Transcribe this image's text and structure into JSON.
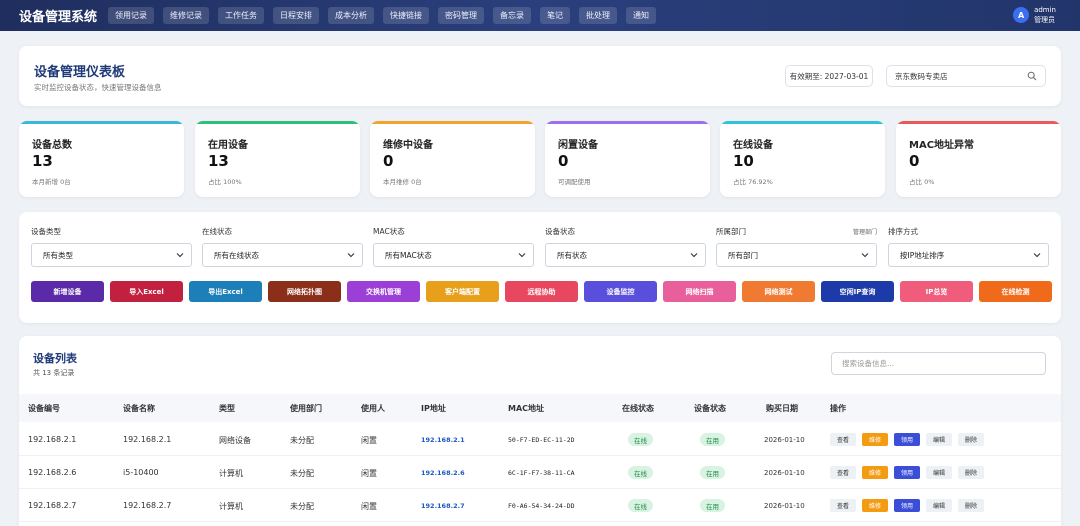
{
  "app": {
    "title": "设备管理系统",
    "nav": [
      "领用记录",
      "维修记录",
      "工作任务",
      "日程安排",
      "成本分析",
      "快捷链接",
      "密码管理",
      "备忘录",
      "笔记",
      "批处理",
      "通知"
    ],
    "user": {
      "avatar": "A",
      "name": "admin",
      "role": "管理员"
    }
  },
  "header": {
    "title": "设备管理仪表板",
    "subtitle": "实时监控设备状态，快速管理设备信息",
    "validity": "有效期至: 2027-03-01",
    "shop": "京东数码专卖店"
  },
  "stats": [
    {
      "label": "设备总数",
      "value": "13",
      "sub": "本月新增 0台",
      "color": "#3bb8d8"
    },
    {
      "label": "在用设备",
      "value": "13",
      "sub": "占比 100%",
      "color": "#2fbf7a"
    },
    {
      "label": "维修中设备",
      "value": "0",
      "sub": "本月维修 0台",
      "color": "#f0a531"
    },
    {
      "label": "闲置设备",
      "value": "0",
      "sub": "可调配使用",
      "color": "#9b6ff0"
    },
    {
      "label": "在线设备",
      "value": "10",
      "sub": "占比 76.92%",
      "color": "#2fc4d8"
    },
    {
      "label": "MAC地址异常",
      "value": "0",
      "sub": "占比 0%",
      "color": "#e85b5b"
    }
  ],
  "filters": {
    "groups": [
      {
        "label": "设备类型",
        "value": "所有类型"
      },
      {
        "label": "在线状态",
        "value": "所有在线状态"
      },
      {
        "label": "MAC状态",
        "value": "所有MAC状态"
      },
      {
        "label": "设备状态",
        "value": "所有状态"
      },
      {
        "label": "所属部门",
        "value": "所有部门",
        "extra": "管理部门"
      },
      {
        "label": "排序方式",
        "value": "按IP地址排序"
      }
    ],
    "buttons": [
      {
        "label": "新增设备",
        "color": "#5b2aa8"
      },
      {
        "label": "导入Excel",
        "color": "#c2203f"
      },
      {
        "label": "导出Excel",
        "color": "#1c7fb8"
      },
      {
        "label": "网络拓扑图",
        "color": "#8c2f1a"
      },
      {
        "label": "交换机管理",
        "color": "#9b3fd6"
      },
      {
        "label": "客户端配置",
        "color": "#e8a01c"
      },
      {
        "label": "远程协助",
        "color": "#e8485f"
      },
      {
        "label": "设备监控",
        "color": "#5a4fdc"
      },
      {
        "label": "网络扫描",
        "color": "#e85f9c"
      },
      {
        "label": "网络测试",
        "color": "#f07a32"
      },
      {
        "label": "空闲IP查询",
        "color": "#1c3aa8"
      },
      {
        "label": "IP总览",
        "color": "#ef5c7c"
      },
      {
        "label": "在线检测",
        "color": "#f06a1c"
      }
    ]
  },
  "table": {
    "title": "设备列表",
    "count": "共 13 条记录",
    "search_placeholder": "搜索设备信息...",
    "columns": [
      "设备编号",
      "设备名称",
      "类型",
      "使用部门",
      "使用人",
      "IP地址",
      "MAC地址",
      "在线状态",
      "设备状态",
      "购买日期",
      "操作"
    ],
    "actions": [
      "查看",
      "维修",
      "领用",
      "编辑",
      "删除"
    ],
    "rows": [
      {
        "id": "192.168.2.1",
        "name": "192.168.2.1",
        "type": "网络设备",
        "dept": "未分配",
        "user": "闲置",
        "ip": "192.168.2.1",
        "mac": "50-F7-ED-EC-11-2D",
        "online": "在线",
        "status": "在用",
        "date": "2026-01-10"
      },
      {
        "id": "192.168.2.6",
        "name": "i5-10400",
        "type": "计算机",
        "dept": "未分配",
        "user": "闲置",
        "ip": "192.168.2.6",
        "mac": "6C-1F-F7-38-11-CA",
        "online": "在线",
        "status": "在用",
        "date": "2026-01-10"
      },
      {
        "id": "192.168.2.7",
        "name": "192.168.2.7",
        "type": "计算机",
        "dept": "未分配",
        "user": "闲置",
        "ip": "192.168.2.7",
        "mac": "F0-A6-54-34-24-DD",
        "online": "在线",
        "status": "在用",
        "date": "2026-01-10"
      }
    ]
  }
}
